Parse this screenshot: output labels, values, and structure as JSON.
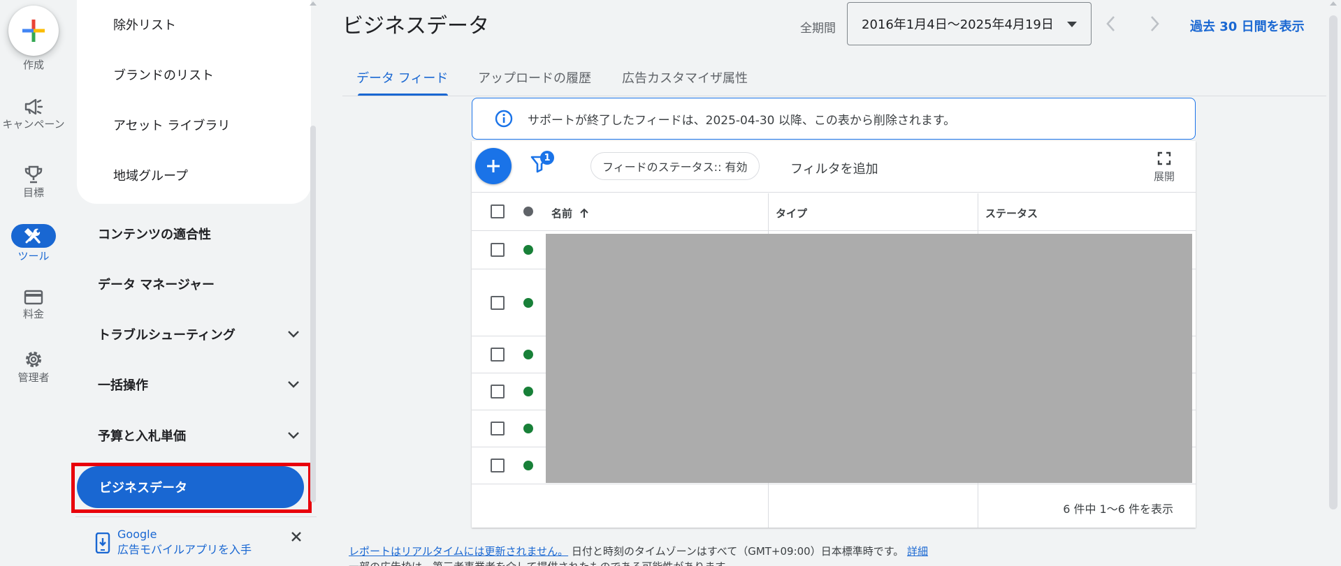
{
  "rail": {
    "create_label": "作成",
    "items": [
      {
        "label": "キャンペーン",
        "icon": "megaphone-icon"
      },
      {
        "label": "目標",
        "icon": "trophy-icon"
      },
      {
        "label": "ツール",
        "icon": "tools-icon"
      },
      {
        "label": "料金",
        "icon": "credit-card-icon"
      },
      {
        "label": "管理者",
        "icon": "gear-icon"
      }
    ]
  },
  "nav": {
    "sub_items": [
      "除外リスト",
      "ブランドのリスト",
      "アセット ライブラリ",
      "地域グループ"
    ],
    "items": [
      {
        "label": "コンテンツの適合性"
      },
      {
        "label": "データ マネージャー"
      },
      {
        "label": "トラブルシューティング"
      },
      {
        "label": "一括操作"
      },
      {
        "label": "予算と入札単価"
      }
    ],
    "active": "ビジネスデータ",
    "promo_line1": "Google",
    "promo_line2": "広告モバイルアプリを入手"
  },
  "header": {
    "title": "ビジネスデータ",
    "period_label": "全期間",
    "date_range": "2016年1月4日～2025年4月19日",
    "last30": "過去 30 日間を表示"
  },
  "tabs": [
    "データ フィード",
    "アップロードの履歴",
    "広告カスタマイザ属性"
  ],
  "notice": "サポートが終了したフィードは、2025-04-30 以降、この表から削除されます。",
  "toolbar": {
    "filter_count": "1",
    "chip": "フィードのステータス:: 有効",
    "add_filter": "フィルタを追加",
    "expand": "展開"
  },
  "table": {
    "columns": [
      "名前",
      "タイプ",
      "ステータス"
    ],
    "sort_column": "名前",
    "rows": 6,
    "status_color": "#188038"
  },
  "footer": {
    "count": "6 件中 1～6 件を表示",
    "note_link": "レポートはリアルタイムには更新されません。",
    "note_text": "日付と時刻のタイムゾーンはすべて（GMT+09:00）日本標準時です。",
    "details_link": "詳細",
    "note2": "一部の広告枠は、第三者事業者を介して提供されたものである可能性があります。"
  }
}
